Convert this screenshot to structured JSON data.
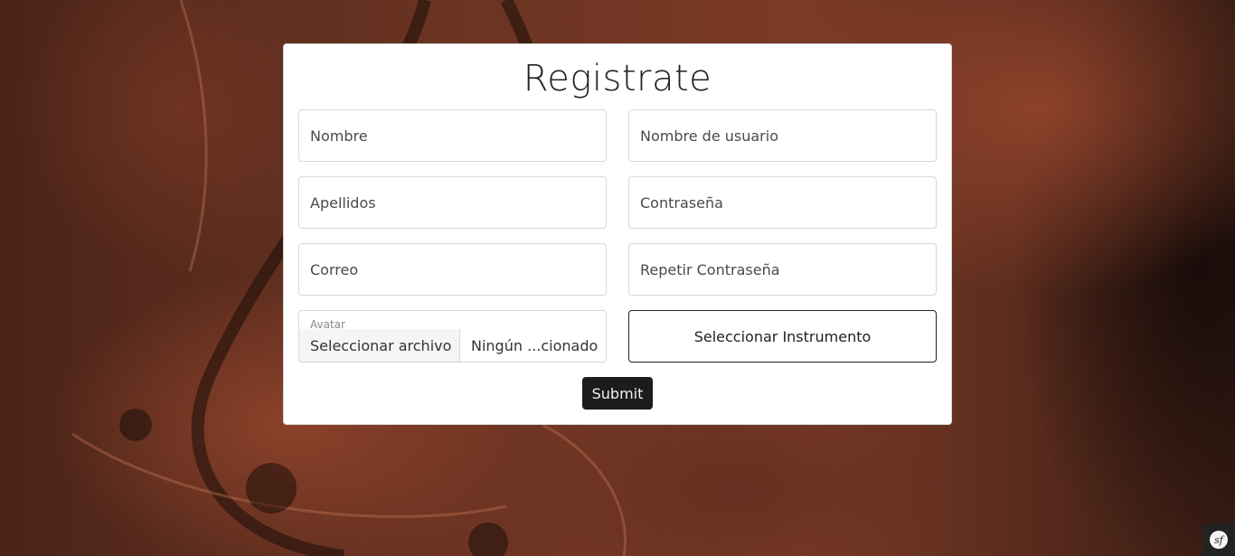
{
  "form": {
    "title": "Registrate",
    "fields": {
      "nombre": {
        "placeholder": "Nombre"
      },
      "usuario": {
        "placeholder": "Nombre de usuario"
      },
      "apellidos": {
        "placeholder": "Apellidos"
      },
      "password": {
        "placeholder": "Contraseña"
      },
      "correo": {
        "placeholder": "Correo"
      },
      "repeat_password": {
        "placeholder": "Repetir Contraseña"
      }
    },
    "avatar": {
      "label": "Avatar",
      "button_label": "Seleccionar archivo",
      "file_name": "Ningún ...cionado"
    },
    "instrument_button": "Seleccionar Instrumento",
    "submit_label": "Submit"
  },
  "debug_toolbar": {
    "icon": "symfony-icon"
  },
  "colors": {
    "submit_bg": "#1c1c1c",
    "card_bg": "#ffffff",
    "background_tint": "#6a3322"
  }
}
